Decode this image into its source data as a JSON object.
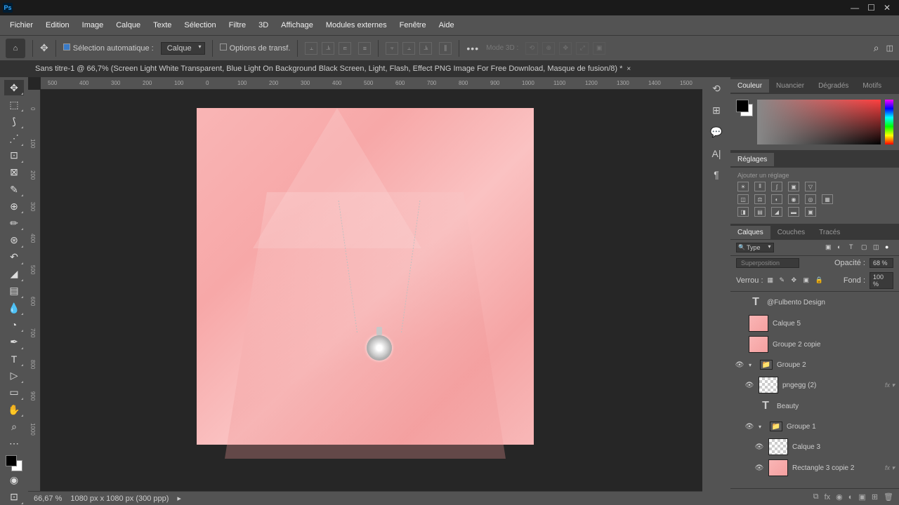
{
  "titlebar": {
    "app": "Ps"
  },
  "menu": [
    "Fichier",
    "Edition",
    "Image",
    "Calque",
    "Texte",
    "Sélection",
    "Filtre",
    "3D",
    "Affichage",
    "Modules externes",
    "Fenêtre",
    "Aide"
  ],
  "options": {
    "auto_select": "Sélection automatique :",
    "target": "Calque",
    "transform": "Options de transf.",
    "mode3d": "Mode 3D :"
  },
  "doc_tab": "Sans titre-1 @ 66,7% (Screen Light White Transparent, Blue Light On Background Black Screen, Light, Flash, Effect PNG Image For Free Download, Masque de fusion/8) *",
  "ruler_h": [
    "500",
    "400",
    "300",
    "200",
    "100",
    "0",
    "100",
    "200",
    "300",
    "400",
    "500",
    "600",
    "700",
    "800",
    "900",
    "1000",
    "1100",
    "1200",
    "1300",
    "1400",
    "1500"
  ],
  "ruler_v": [
    "0",
    "100",
    "200",
    "300",
    "400",
    "500",
    "600",
    "700",
    "800",
    "900",
    "1000"
  ],
  "status": {
    "zoom": "66,67 %",
    "dims": "1080 px x 1080 px (300 ppp)"
  },
  "color_tabs": [
    "Couleur",
    "Nuancier",
    "Dégradés",
    "Motifs"
  ],
  "adjust": {
    "title": "Réglages",
    "add": "Ajouter un réglage"
  },
  "layer_tabs": [
    "Calques",
    "Couches",
    "Tracés"
  ],
  "layers": {
    "type": "Type",
    "blend": "Superposition",
    "opacity_lbl": "Opacité :",
    "opacity": "68 %",
    "lock": "Verrou :",
    "fill_lbl": "Fond :",
    "fill": "100 %",
    "items": [
      {
        "name": "@Fulbento Design",
        "thumb": "txt",
        "vis": false
      },
      {
        "name": "Calque 5",
        "thumb": "pink",
        "vis": false
      },
      {
        "name": "Groupe 2 copie",
        "thumb": "pink",
        "vis": false
      },
      {
        "name": "Groupe 2",
        "thumb": "folder",
        "vis": true,
        "group": true,
        "open": true
      },
      {
        "name": "pngegg (2)",
        "thumb": "checker",
        "vis": true,
        "indent": 1,
        "fx": true
      },
      {
        "name": "Beauty",
        "thumb": "txt",
        "vis": false,
        "indent": 1
      },
      {
        "name": "Groupe 1",
        "thumb": "folder",
        "vis": true,
        "indent": 1,
        "group": true,
        "open": true
      },
      {
        "name": "Calque 3",
        "thumb": "checker",
        "vis": true,
        "indent": 2
      },
      {
        "name": "Rectangle 3 copie 2",
        "thumb": "pink",
        "vis": true,
        "indent": 2,
        "fx": true
      }
    ]
  }
}
